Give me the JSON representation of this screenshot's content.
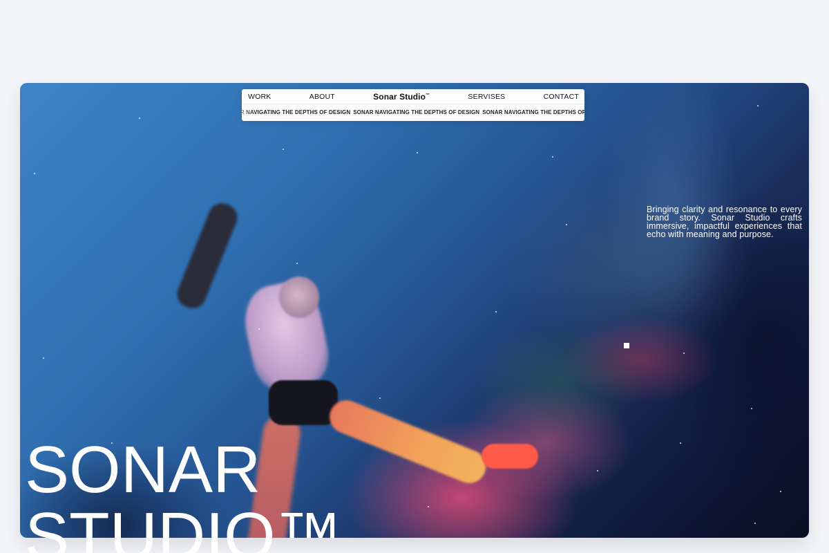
{
  "nav": {
    "left_links": [
      "WORK",
      "ABOUT"
    ],
    "brand": "Sonar Studio",
    "brand_mark": "™",
    "right_links": [
      "SERVISES",
      "CONTACT"
    ]
  },
  "ticker": {
    "items": [
      "NAR NAVIGATING THE DEPTHS OF DESIGN",
      "SONAR NAVIGATING THE DEPTHS OF DESIGN",
      "SONAR NAVIGATING THE DEPTHS OF DESIGN SO"
    ]
  },
  "hero": {
    "tagline": "Bringing clarity and resonance to every brand story. Sonar Studio crafts immersive, impactful experiences that echo with meaning and purpose.",
    "title_line_1": "SONAR",
    "title_line_2": "STUDIO™"
  },
  "colors": {
    "background": "#f4f5f8",
    "nav_background": "#ffffff",
    "text_dark": "#111111",
    "text_light": "#ffffff"
  }
}
